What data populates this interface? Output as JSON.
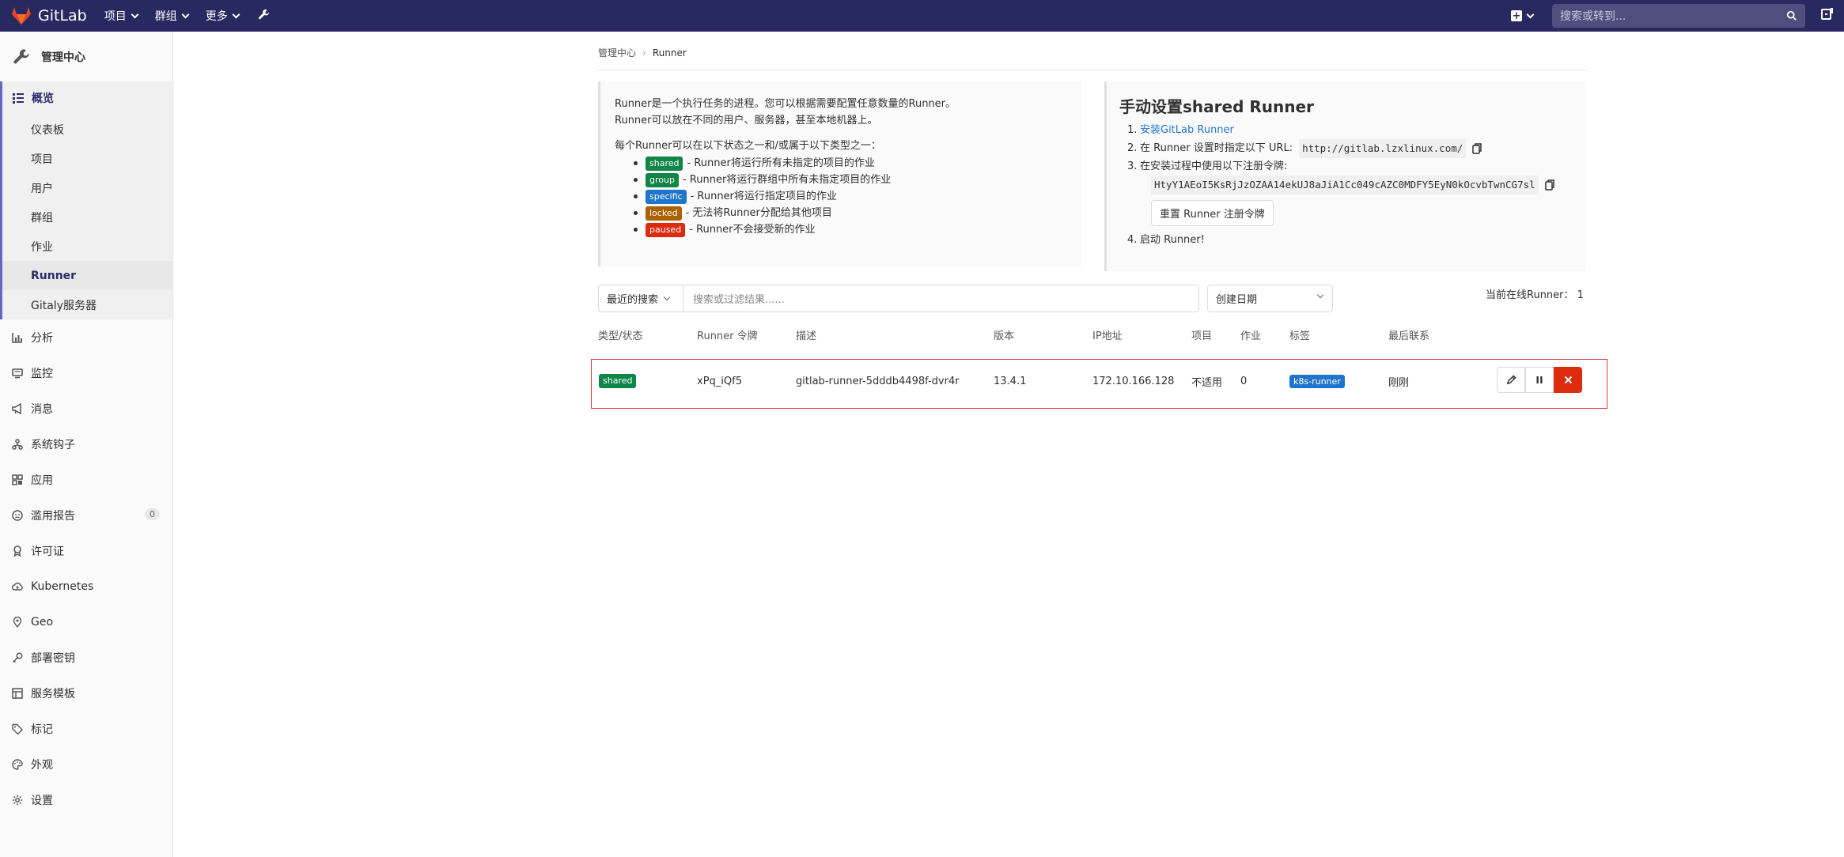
{
  "topnav": {
    "brand": "GitLab",
    "menus": [
      "项目",
      "群组",
      "更多"
    ],
    "search_placeholder": "搜索或转到..."
  },
  "sidebar": {
    "title": "管理中心",
    "overview_label": "概览",
    "overview_items": [
      "仪表板",
      "项目",
      "用户",
      "群组",
      "作业",
      "Runner",
      "Gitaly服务器"
    ],
    "active_item": "Runner",
    "items": [
      {
        "label": "分析",
        "icon": "chart-icon"
      },
      {
        "label": "监控",
        "icon": "monitor-icon"
      },
      {
        "label": "消息",
        "icon": "bullhorn-icon"
      },
      {
        "label": "系统钩子",
        "icon": "hook-icon"
      },
      {
        "label": "应用",
        "icon": "apps-icon"
      },
      {
        "label": "滥用报告",
        "icon": "face-icon",
        "count": "0"
      },
      {
        "label": "许可证",
        "icon": "license-icon"
      },
      {
        "label": "Kubernetes",
        "icon": "cloud-icon"
      },
      {
        "label": "Geo",
        "icon": "location-icon"
      },
      {
        "label": "部署密钥",
        "icon": "key-icon"
      },
      {
        "label": "服务模板",
        "icon": "template-icon"
      },
      {
        "label": "标记",
        "icon": "label-icon"
      },
      {
        "label": "外观",
        "icon": "appearance-icon"
      },
      {
        "label": "设置",
        "icon": "gear-icon"
      }
    ]
  },
  "breadcrumb": [
    "管理中心",
    "Runner"
  ],
  "info": {
    "line1": "Runner是一个执行任务的进程。您可以根据需要配置任意数量的Runner。",
    "line2": "Runner可以放在不同的用户、服务器，甚至本地机器上。",
    "states_intro": "每个Runner可以在以下状态之一和/或属于以下类型之一：",
    "states": [
      {
        "tag": "shared",
        "desc": "- Runner将运行所有未指定的项目的作业"
      },
      {
        "tag": "group",
        "desc": "- Runner将运行群组中所有未指定项目的作业"
      },
      {
        "tag": "specific",
        "desc": "- Runner将运行指定项目的作业"
      },
      {
        "tag": "locked",
        "desc": "- 无法将Runner分配给其他项目"
      },
      {
        "tag": "paused",
        "desc": "- Runner不会接受新的作业"
      }
    ]
  },
  "setup": {
    "title": "手动设置shared Runner",
    "step1_num": "1.",
    "step1_link": "安装GitLab Runner",
    "step2_num": "2.",
    "step2_text": "在 Runner 设置时指定以下 URL:",
    "url": "http://gitlab.lzxlinux.com/",
    "step3_num": "3.",
    "step3_text": "在安装过程中使用以下注册令牌:",
    "token": "HtyY1AEoI5KsRjJzOZAA14ekUJ8aJiA1Cc049cAZC0MDFY5EyN0kOcvbTwnCG7sl",
    "reset_button": "重置 Runner 注册令牌",
    "step4_num": "4.",
    "step4_text": "启动 Runner!"
  },
  "filter": {
    "recent_label": "最近的搜索",
    "search_placeholder": "搜索或过滤结果......",
    "sort_label": "创建日期",
    "online_label": "当前在线Runner：",
    "online_count": "1"
  },
  "table": {
    "headers": [
      "类型/状态",
      "Runner 令牌",
      "描述",
      "版本",
      "IP地址",
      "项目",
      "作业",
      "标签",
      "最后联系"
    ],
    "row": {
      "type": "shared",
      "token": "xPq_iQf5",
      "description": "gitlab-runner-5dddb4498f-dvr4r",
      "version": "13.4.1",
      "ip": "172.10.166.128",
      "projects": "不适用",
      "jobs": "0",
      "tag": "k8s-runner",
      "last_contact": "刚刚"
    }
  },
  "colors": {
    "nav_bg": "#292961",
    "accent": "#6666c4",
    "delete": "#dd2b0e",
    "shared": "#108548",
    "specific": "#1f75cb",
    "locked": "#ab6100"
  }
}
